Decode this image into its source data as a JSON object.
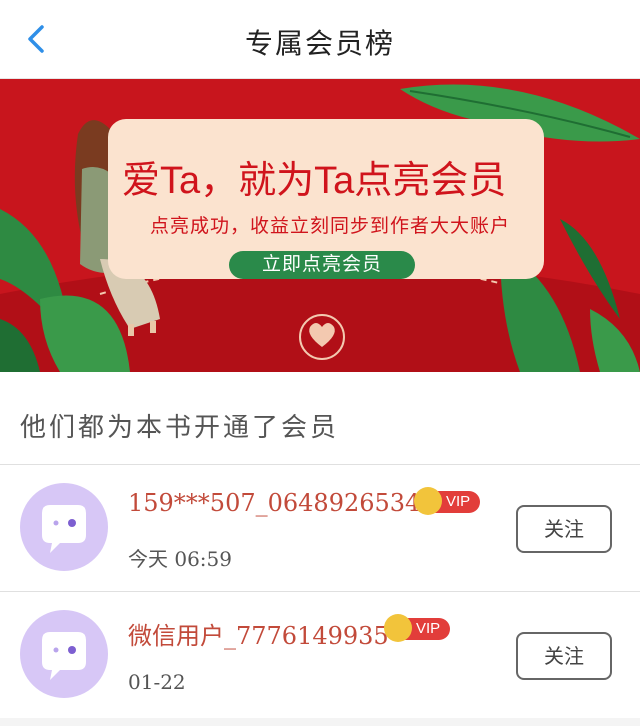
{
  "header": {
    "title": "专属会员榜",
    "back_icon": "chevron-left-icon"
  },
  "banner": {
    "headline": "爱Ta，就为Ta点亮会员",
    "subtitle": "点亮成功，收益立刻同步到作者大大账户",
    "cta_label": "立即点亮会员"
  },
  "section": {
    "title": "他们都为本书开通了会员"
  },
  "members": [
    {
      "name": "159***507_0648926534",
      "badge": "VIP",
      "time": "今天 06:59",
      "follow_label": "关注"
    },
    {
      "name": "微信用户_7776149935",
      "badge": "VIP",
      "time": "01-22",
      "follow_label": "关注"
    }
  ],
  "colors": {
    "accent_blue": "#2f8fe8",
    "banner_red": "#c8151d",
    "cta_green": "#2a8a4a",
    "vip_red": "#e23d3a",
    "crown_gold": "#f2c43b",
    "avatar_purple": "#d7c7f6",
    "name_red": "#c24a3a"
  }
}
